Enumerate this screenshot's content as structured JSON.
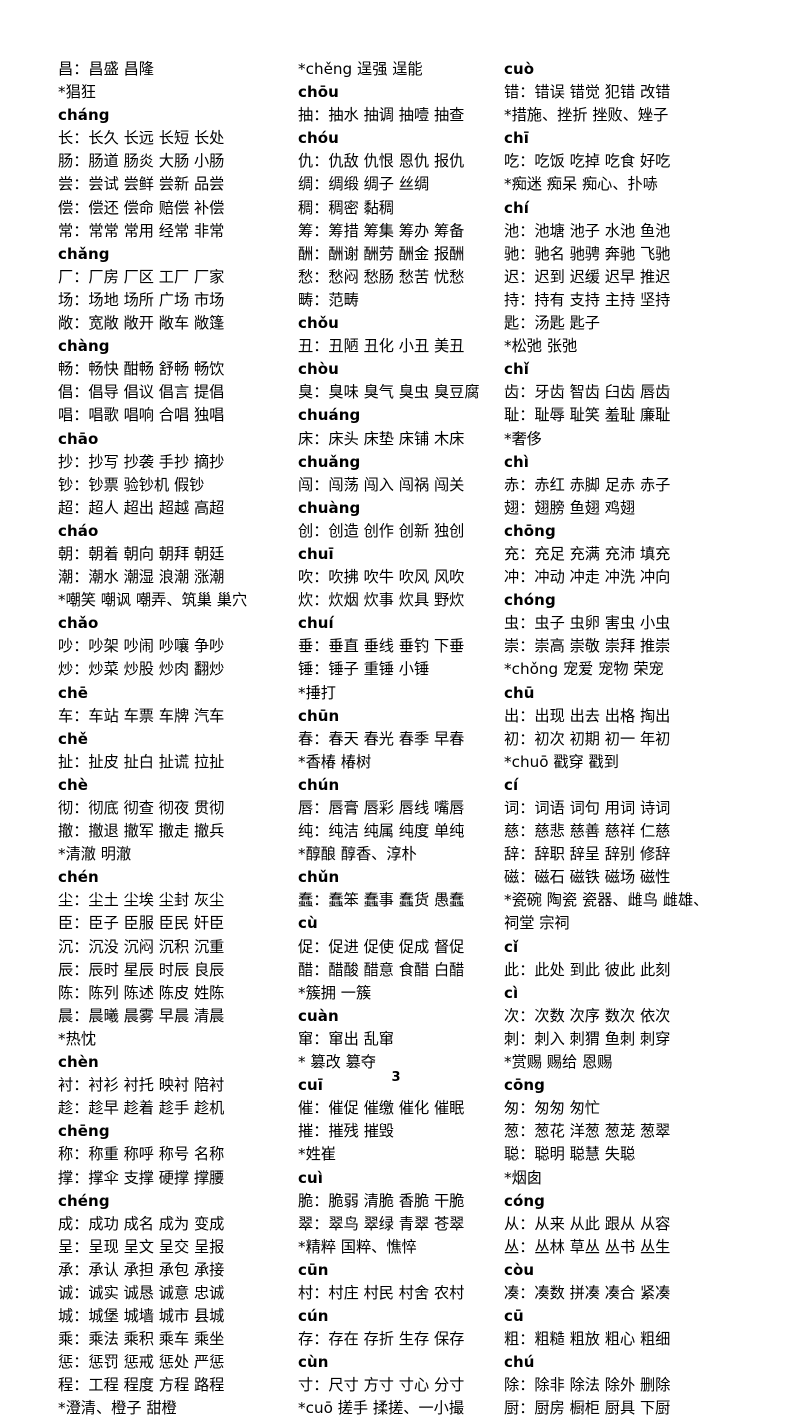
{
  "document": {
    "type": "chinese-pinyin-vocabulary-list",
    "page_number": "3"
  },
  "columns": [
    {
      "id": "column-1",
      "lines": [
        {
          "kind": "entry",
          "text": "昌：昌盛 昌隆"
        },
        {
          "kind": "note",
          "text": "*猖狂"
        },
        {
          "kind": "pinyin",
          "text": "cháng"
        },
        {
          "kind": "entry",
          "text": "长：长久 长远 长短 长处"
        },
        {
          "kind": "entry",
          "text": "肠：肠道 肠炎 大肠 小肠"
        },
        {
          "kind": "entry",
          "text": "尝：尝试 尝鲜 尝新 品尝"
        },
        {
          "kind": "entry",
          "text": "偿：偿还 偿命 赔偿 补偿"
        },
        {
          "kind": "entry",
          "text": "常：常常 常用 经常 非常"
        },
        {
          "kind": "pinyin",
          "text": "chǎng"
        },
        {
          "kind": "entry",
          "text": "厂：厂房 厂区 工厂 厂家"
        },
        {
          "kind": "entry",
          "text": "场：场地 场所 广场 市场"
        },
        {
          "kind": "entry",
          "text": "敞：宽敞 敞开 敞车 敞篷"
        },
        {
          "kind": "pinyin",
          "text": "chàng"
        },
        {
          "kind": "entry",
          "text": "畅：畅快 酣畅 舒畅 畅饮"
        },
        {
          "kind": "entry",
          "text": "倡：倡导 倡议 倡言 提倡"
        },
        {
          "kind": "entry",
          "text": "唱：唱歌 唱响 合唱 独唱"
        },
        {
          "kind": "pinyin",
          "text": "chāo"
        },
        {
          "kind": "entry",
          "text": "抄：抄写 抄袭 手抄 摘抄"
        },
        {
          "kind": "entry",
          "text": "钞：钞票 验钞机 假钞"
        },
        {
          "kind": "entry",
          "text": "超：超人 超出 超越 高超"
        },
        {
          "kind": "pinyin",
          "text": "cháo"
        },
        {
          "kind": "entry",
          "text": "朝：朝着 朝向 朝拜 朝廷"
        },
        {
          "kind": "entry",
          "text": "潮：潮水 潮湿 浪潮 涨潮"
        },
        {
          "kind": "note",
          "text": "*嘲笑 嘲讽 嘲弄、筑巢 巢穴"
        },
        {
          "kind": "pinyin",
          "text": "chǎo"
        },
        {
          "kind": "entry",
          "text": "吵：吵架 吵闹 吵嚷 争吵"
        },
        {
          "kind": "entry",
          "text": "炒：炒菜 炒股 炒肉 翻炒"
        },
        {
          "kind": "pinyin",
          "text": "chē"
        },
        {
          "kind": "entry",
          "text": "车：车站 车票 车牌 汽车"
        },
        {
          "kind": "pinyin",
          "text": "chě"
        },
        {
          "kind": "entry",
          "text": "扯：扯皮 扯白 扯谎 拉扯"
        },
        {
          "kind": "pinyin",
          "text": "chè"
        },
        {
          "kind": "entry",
          "text": "彻：彻底 彻查 彻夜 贯彻"
        },
        {
          "kind": "entry",
          "text": "撤：撤退 撤军 撤走 撤兵"
        },
        {
          "kind": "note",
          "text": "*清澈 明澈"
        },
        {
          "kind": "pinyin",
          "text": "chén"
        },
        {
          "kind": "entry",
          "text": "尘：尘土 尘埃 尘封 灰尘"
        },
        {
          "kind": "entry",
          "text": "臣：臣子 臣服 臣民 奸臣"
        },
        {
          "kind": "entry",
          "text": "沉：沉没 沉闷 沉积 沉重"
        },
        {
          "kind": "entry",
          "text": "辰：辰时 星辰 时辰 良辰"
        },
        {
          "kind": "entry",
          "text": "陈：陈列 陈述 陈皮 姓陈"
        },
        {
          "kind": "entry",
          "text": "晨：晨曦 晨雾 早晨 清晨"
        },
        {
          "kind": "note",
          "text": "*热忱"
        },
        {
          "kind": "pinyin",
          "text": "chèn"
        },
        {
          "kind": "entry",
          "text": "衬：衬衫 衬托 映衬 陪衬"
        },
        {
          "kind": "entry",
          "text": "趁：趁早 趁着 趁手 趁机"
        },
        {
          "kind": "pinyin",
          "text": "chēng"
        },
        {
          "kind": "entry",
          "text": "称：称重 称呼 称号 名称"
        },
        {
          "kind": "entry",
          "text": "撑：撑伞 支撑 硬撑 撑腰"
        },
        {
          "kind": "pinyin",
          "text": "chéng"
        },
        {
          "kind": "entry",
          "text": "成：成功 成名 成为 变成"
        },
        {
          "kind": "entry",
          "text": "呈：呈现 呈文 呈交 呈报"
        },
        {
          "kind": "entry",
          "text": "承：承认 承担 承包 承接"
        },
        {
          "kind": "entry",
          "text": "诚：诚实 诚恳 诚意 忠诚"
        },
        {
          "kind": "entry",
          "text": "城：城堡 城墙 城市 县城"
        },
        {
          "kind": "entry",
          "text": "乘：乘法 乘积 乘车 乘坐"
        },
        {
          "kind": "entry",
          "text": "惩：惩罚 惩戒 惩处 严惩"
        },
        {
          "kind": "entry",
          "text": "程：工程 程度 方程 路程"
        },
        {
          "kind": "note",
          "text": "*澄清、橙子 甜橙"
        }
      ]
    },
    {
      "id": "column-2",
      "lines": [
        {
          "kind": "note",
          "text": "*chěng 逞强 逞能"
        },
        {
          "kind": "pinyin",
          "text": "chōu"
        },
        {
          "kind": "entry",
          "text": "抽：抽水 抽调 抽噎 抽查"
        },
        {
          "kind": "pinyin",
          "text": "chóu"
        },
        {
          "kind": "entry",
          "text": "仇：仇敌 仇恨 恩仇 报仇"
        },
        {
          "kind": "entry",
          "text": "绸：绸缎 绸子 丝绸"
        },
        {
          "kind": "entry",
          "text": "稠：稠密 黏稠"
        },
        {
          "kind": "entry",
          "text": "筹：筹措 筹集 筹办 筹备"
        },
        {
          "kind": "entry",
          "text": "酬：酬谢 酬劳 酬金 报酬"
        },
        {
          "kind": "entry",
          "text": "愁：愁闷 愁肠 愁苦 忧愁"
        },
        {
          "kind": "entry",
          "text": "畴：范畴"
        },
        {
          "kind": "pinyin",
          "text": "chǒu"
        },
        {
          "kind": "entry",
          "text": "丑：丑陋 丑化 小丑 美丑"
        },
        {
          "kind": "pinyin",
          "text": "chòu"
        },
        {
          "kind": "entry",
          "text": "臭：臭味 臭气 臭虫 臭豆腐"
        },
        {
          "kind": "pinyin",
          "text": "chuáng"
        },
        {
          "kind": "entry",
          "text": "床：床头 床垫 床铺 木床"
        },
        {
          "kind": "pinyin",
          "text": "chuǎng"
        },
        {
          "kind": "entry",
          "text": "闯：闯荡 闯入 闯祸 闯关"
        },
        {
          "kind": "pinyin",
          "text": "chuàng"
        },
        {
          "kind": "entry",
          "text": "创：创造 创作 创新 独创"
        },
        {
          "kind": "pinyin",
          "text": "chuī"
        },
        {
          "kind": "entry",
          "text": "吹：吹拂 吹牛 吹风 风吹"
        },
        {
          "kind": "entry",
          "text": "炊：炊烟 炊事 炊具 野炊"
        },
        {
          "kind": "pinyin",
          "text": "chuí"
        },
        {
          "kind": "entry",
          "text": "垂：垂直 垂线 垂钓 下垂"
        },
        {
          "kind": "entry",
          "text": "锤：锤子 重锤 小锤"
        },
        {
          "kind": "note",
          "text": "*捶打"
        },
        {
          "kind": "pinyin",
          "text": "chūn"
        },
        {
          "kind": "entry",
          "text": "春：春天 春光 春季 早春"
        },
        {
          "kind": "note",
          "text": "*香椿 椿树"
        },
        {
          "kind": "pinyin",
          "text": "chún"
        },
        {
          "kind": "entry",
          "text": "唇：唇膏 唇彩 唇线 嘴唇"
        },
        {
          "kind": "entry",
          "text": "纯：纯洁 纯属 纯度 单纯"
        },
        {
          "kind": "note",
          "text": "*醇酿 醇香、淳朴"
        },
        {
          "kind": "pinyin",
          "text": "chǔn"
        },
        {
          "kind": "entry",
          "text": "蠢：蠢笨 蠢事 蠢货 愚蠢"
        },
        {
          "kind": "pinyin",
          "text": "cù"
        },
        {
          "kind": "entry",
          "text": "促：促进 促使 促成 督促"
        },
        {
          "kind": "entry",
          "text": "醋：醋酸 醋意 食醋 白醋"
        },
        {
          "kind": "note",
          "text": "*簇拥 一簇"
        },
        {
          "kind": "pinyin",
          "text": "cuàn"
        },
        {
          "kind": "entry",
          "text": "窜：窜出 乱窜"
        },
        {
          "kind": "note",
          "text": "* 篡改 篡夺"
        },
        {
          "kind": "pinyin",
          "text": "cuī"
        },
        {
          "kind": "entry",
          "text": "催：催促 催缴 催化 催眠"
        },
        {
          "kind": "entry",
          "text": "摧：摧残 摧毁"
        },
        {
          "kind": "note",
          "text": "*姓崔"
        },
        {
          "kind": "pinyin",
          "text": "cuì"
        },
        {
          "kind": "entry",
          "text": "脆：脆弱 清脆 香脆 干脆"
        },
        {
          "kind": "entry",
          "text": "翠：翠鸟 翠绿 青翠 苍翠"
        },
        {
          "kind": "note",
          "text": "*精粹 国粹、憔悴"
        },
        {
          "kind": "pinyin",
          "text": "cūn"
        },
        {
          "kind": "entry",
          "text": "村：村庄 村民 村舍 农村"
        },
        {
          "kind": "pinyin",
          "text": "cún"
        },
        {
          "kind": "entry",
          "text": "存：存在 存折 生存 保存"
        },
        {
          "kind": "pinyin",
          "text": "cùn"
        },
        {
          "kind": "entry",
          "text": "寸：尺寸 方寸 寸心 分寸"
        },
        {
          "kind": "note",
          "text": "*cuō 搓手 揉搓、一小撮"
        }
      ]
    },
    {
      "id": "column-3",
      "lines": [
        {
          "kind": "pinyin",
          "text": "cuò"
        },
        {
          "kind": "entry",
          "text": "错：错误 错觉 犯错 改错"
        },
        {
          "kind": "note",
          "text": "*措施、挫折 挫败、矬子"
        },
        {
          "kind": "pinyin",
          "text": "chī"
        },
        {
          "kind": "entry",
          "text": "吃：吃饭 吃掉 吃食 好吃"
        },
        {
          "kind": "note",
          "text": "*痴迷 痴呆 痴心、扑哧"
        },
        {
          "kind": "pinyin",
          "text": "chí"
        },
        {
          "kind": "entry",
          "text": "池：池塘 池子 水池 鱼池"
        },
        {
          "kind": "entry",
          "text": "驰：驰名 驰骋 奔驰 飞驰"
        },
        {
          "kind": "entry",
          "text": "迟：迟到 迟缓 迟早 推迟"
        },
        {
          "kind": "entry",
          "text": "持：持有 支持 主持 坚持"
        },
        {
          "kind": "entry",
          "text": "匙：汤匙 匙子"
        },
        {
          "kind": "note",
          "text": "*松弛 张弛"
        },
        {
          "kind": "pinyin",
          "text": "chǐ"
        },
        {
          "kind": "entry",
          "text": "齿：牙齿 智齿 臼齿 唇齿"
        },
        {
          "kind": "entry",
          "text": "耻：耻辱 耻笑 羞耻 廉耻"
        },
        {
          "kind": "note",
          "text": "*奢侈"
        },
        {
          "kind": "pinyin",
          "text": "chì"
        },
        {
          "kind": "entry",
          "text": "赤：赤红 赤脚 足赤 赤子"
        },
        {
          "kind": "entry",
          "text": "翅：翅膀 鱼翅 鸡翅"
        },
        {
          "kind": "pinyin",
          "text": "chōng"
        },
        {
          "kind": "entry",
          "text": "充：充足 充满 充沛 填充"
        },
        {
          "kind": "entry",
          "text": "冲：冲动 冲走 冲洗 冲向"
        },
        {
          "kind": "pinyin",
          "text": "chóng"
        },
        {
          "kind": "entry",
          "text": "虫：虫子 虫卵 害虫 小虫"
        },
        {
          "kind": "entry",
          "text": "崇：崇高 崇敬 崇拜 推崇"
        },
        {
          "kind": "note",
          "text": "*chǒng 宠爱 宠物 荣宠"
        },
        {
          "kind": "pinyin",
          "text": "chū"
        },
        {
          "kind": "entry",
          "text": "出：出现 出去 出格 掏出"
        },
        {
          "kind": "entry",
          "text": "初：初次 初期 初一 年初"
        },
        {
          "kind": "note",
          "text": "*chuō 戳穿 戳到"
        },
        {
          "kind": "pinyin",
          "text": "cí"
        },
        {
          "kind": "entry",
          "text": "词：词语 词句 用词 诗词"
        },
        {
          "kind": "entry",
          "text": "慈：慈悲 慈善 慈祥 仁慈"
        },
        {
          "kind": "entry",
          "text": "辞：辞职 辞呈 辞别 修辞"
        },
        {
          "kind": "entry",
          "text": "磁：磁石 磁铁 磁场 磁性"
        },
        {
          "kind": "note",
          "text": "*瓷碗 陶瓷 瓷器、雌鸟 雌雄、"
        },
        {
          "kind": "cont",
          "text": "祠堂 宗祠"
        },
        {
          "kind": "pinyin",
          "text": "cǐ"
        },
        {
          "kind": "entry",
          "text": "此：此处 到此 彼此 此刻"
        },
        {
          "kind": "pinyin",
          "text": "cì"
        },
        {
          "kind": "entry",
          "text": "次：次数 次序 数次 依次"
        },
        {
          "kind": "entry",
          "text": "刺：刺入 刺猬 鱼刺 刺穿"
        },
        {
          "kind": "note",
          "text": "*赏赐 赐给 恩赐"
        },
        {
          "kind": "pinyin",
          "text": "cōng"
        },
        {
          "kind": "entry",
          "text": "匆：匆匆 匆忙"
        },
        {
          "kind": "entry",
          "text": "葱：葱花 洋葱 葱茏 葱翠"
        },
        {
          "kind": "entry",
          "text": "聪：聪明 聪慧 失聪"
        },
        {
          "kind": "note",
          "text": "*烟囱"
        },
        {
          "kind": "pinyin",
          "text": "cóng"
        },
        {
          "kind": "entry",
          "text": "从：从来 从此 跟从 从容"
        },
        {
          "kind": "entry",
          "text": "丛：丛林 草丛 丛书 丛生"
        },
        {
          "kind": "pinyin",
          "text": "còu"
        },
        {
          "kind": "entry",
          "text": "凑：凑数 拼凑 凑合 紧凑"
        },
        {
          "kind": "pinyin",
          "text": "cū"
        },
        {
          "kind": "entry",
          "text": "粗：粗糙 粗放 粗心 粗细"
        },
        {
          "kind": "pinyin",
          "text": "chú"
        },
        {
          "kind": "entry",
          "text": "除：除非 除法 除外 删除"
        },
        {
          "kind": "entry",
          "text": "厨：厨房 橱柜 厨具 下厨"
        }
      ]
    }
  ]
}
